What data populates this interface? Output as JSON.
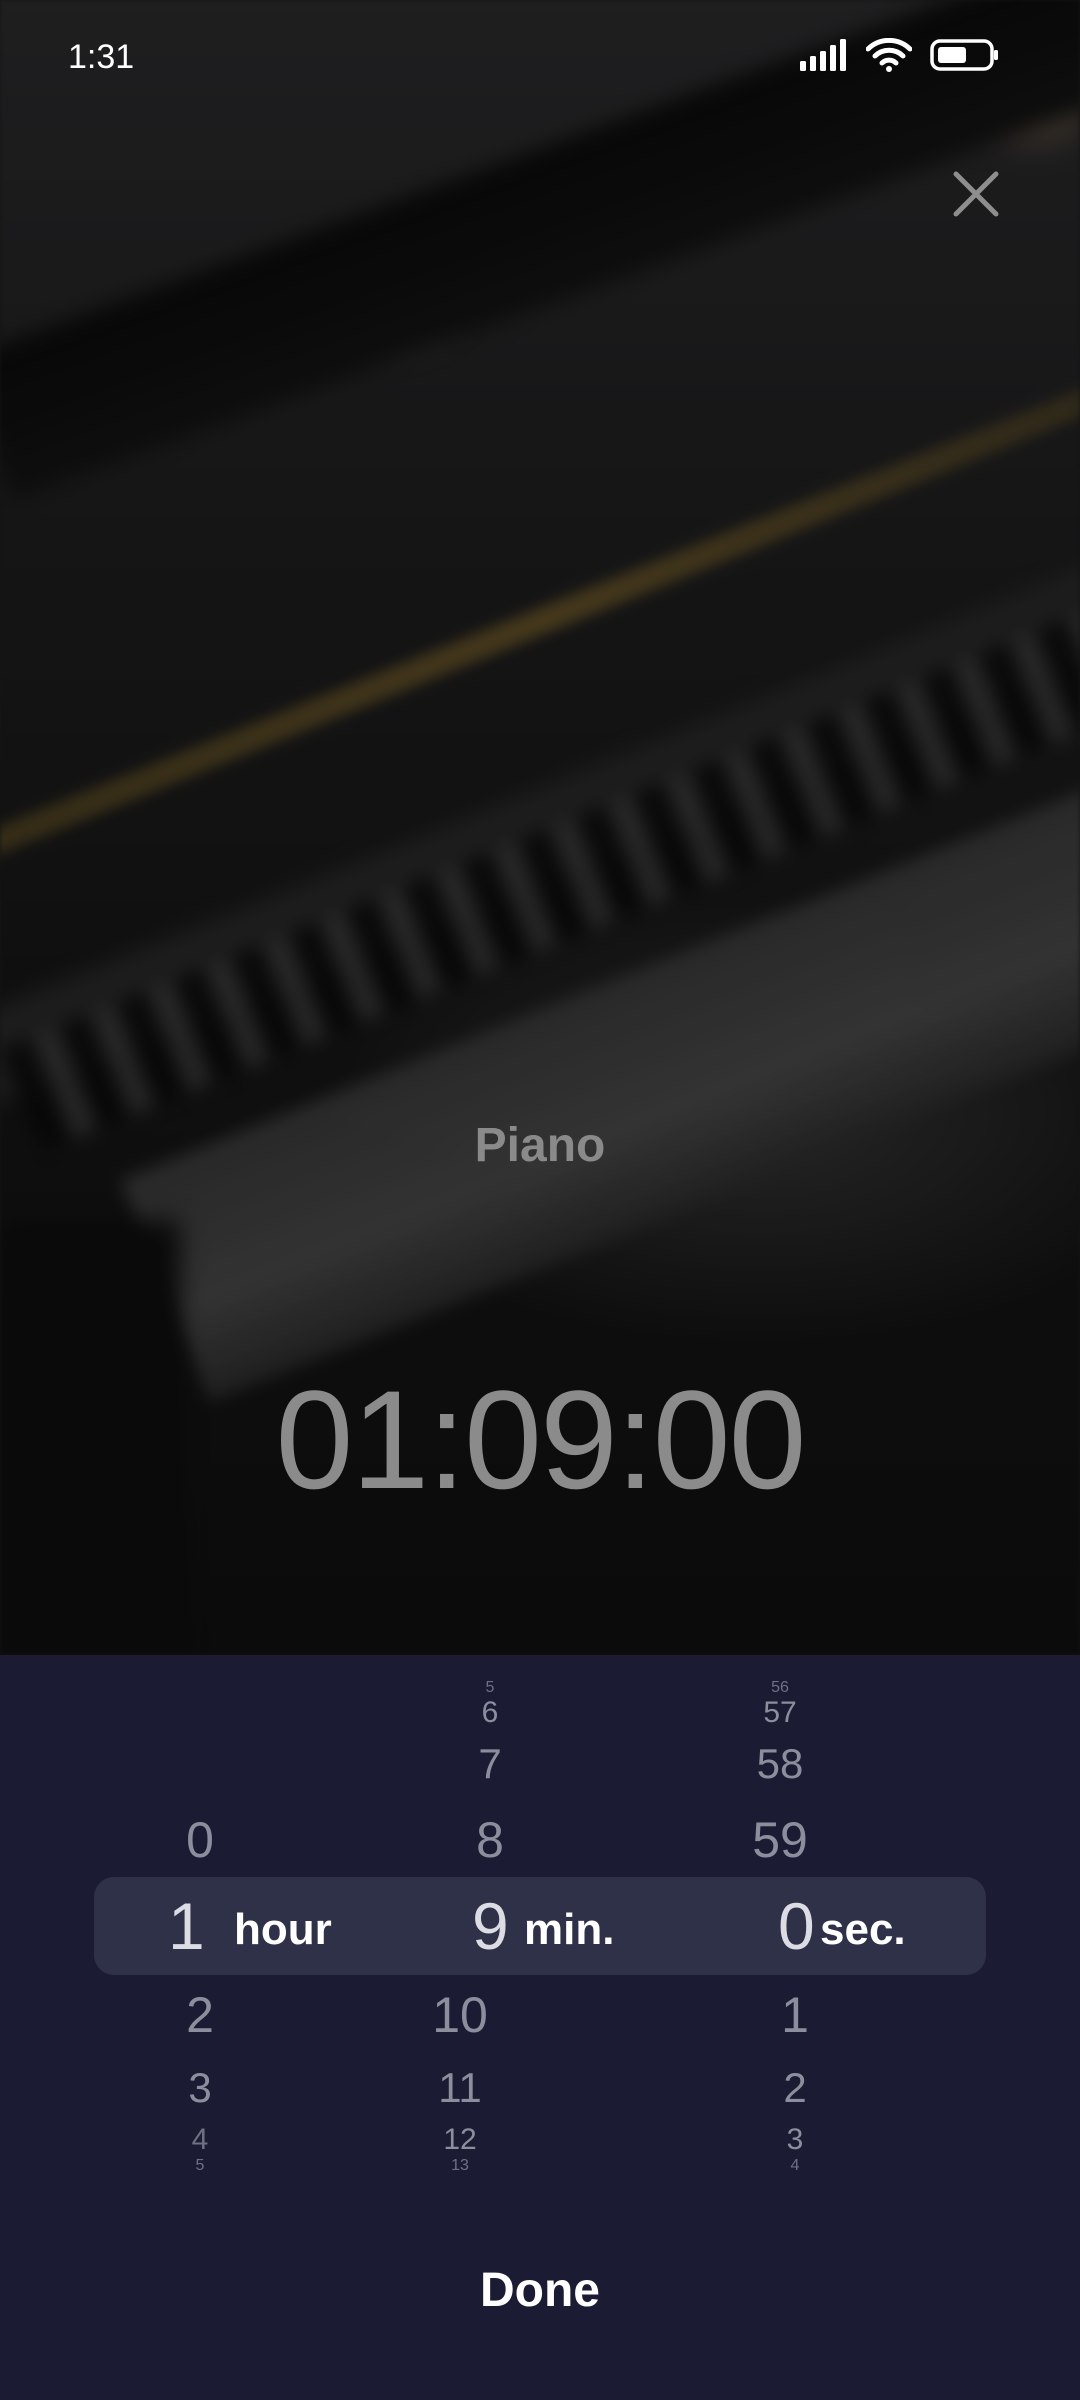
{
  "status_bar": {
    "time": "1:31"
  },
  "sound": {
    "title": "Piano"
  },
  "timer": {
    "display": "01:09:00"
  },
  "picker": {
    "hours": {
      "above": [
        "0"
      ],
      "selected": "1",
      "below": [
        "2",
        "3",
        "4",
        "5"
      ],
      "unit": "hour"
    },
    "minutes": {
      "above": [
        "5",
        "6",
        "7",
        "8"
      ],
      "selected": "9",
      "below": [
        "10",
        "11",
        "12",
        "13"
      ],
      "unit": "min."
    },
    "seconds": {
      "above": [
        "56",
        "57",
        "58",
        "59"
      ],
      "selected": "0",
      "below": [
        "1",
        "2",
        "3",
        "4"
      ],
      "unit": "sec."
    }
  },
  "actions": {
    "done": "Done"
  },
  "icons": {
    "close": "close-icon",
    "signal": "signal-icon",
    "wifi": "wifi-icon",
    "battery": "battery-icon"
  }
}
